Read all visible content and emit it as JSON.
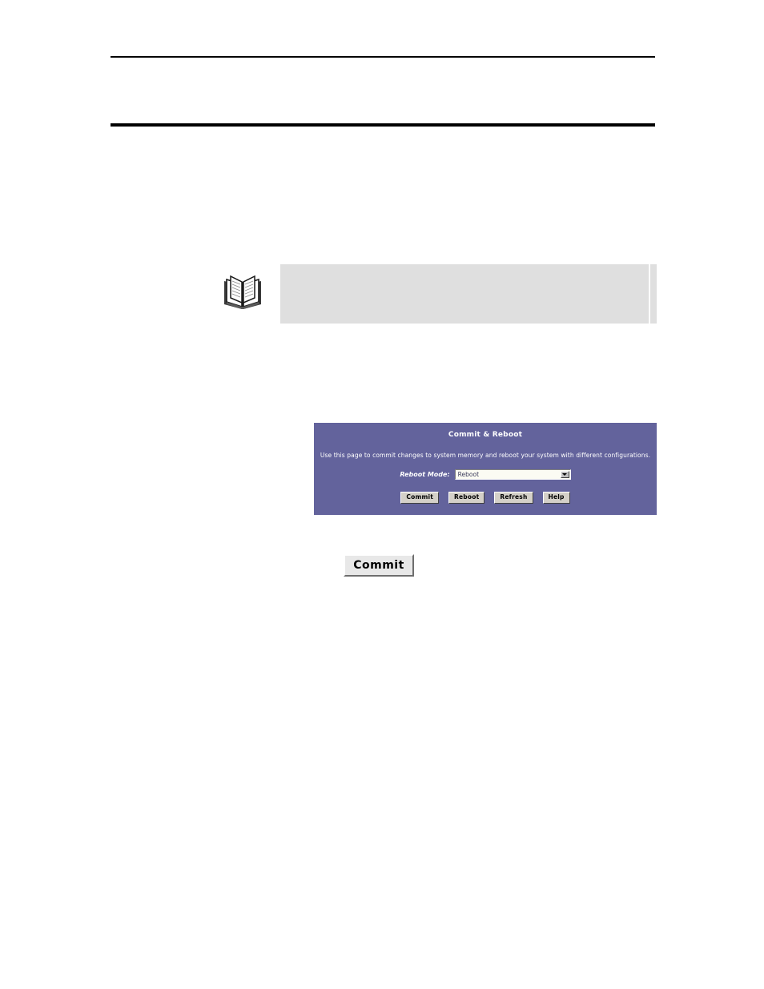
{
  "page": {
    "background_color": "#ffffff",
    "header_rule_color": "#000000",
    "intro_text": "",
    "body_text": ""
  },
  "note": {
    "icon": "open-book-icon",
    "box_color": "#dfdfdf",
    "text": ""
  },
  "ui_panel": {
    "title": "Commit & Reboot",
    "description": "Use this page to commit changes to system memory and reboot your system with different configurations.",
    "background_color": "#63639c",
    "text_color": "#ffffff",
    "field": {
      "label": "Reboot Mode:",
      "value": "Reboot",
      "options": [
        "Reboot"
      ],
      "dropdown_icon": "chevron-down-icon"
    },
    "buttons": [
      {
        "label": "Commit"
      },
      {
        "label": "Reboot"
      },
      {
        "label": "Refresh"
      },
      {
        "label": "Help"
      }
    ]
  },
  "standalone_button": {
    "label": "Commit"
  }
}
